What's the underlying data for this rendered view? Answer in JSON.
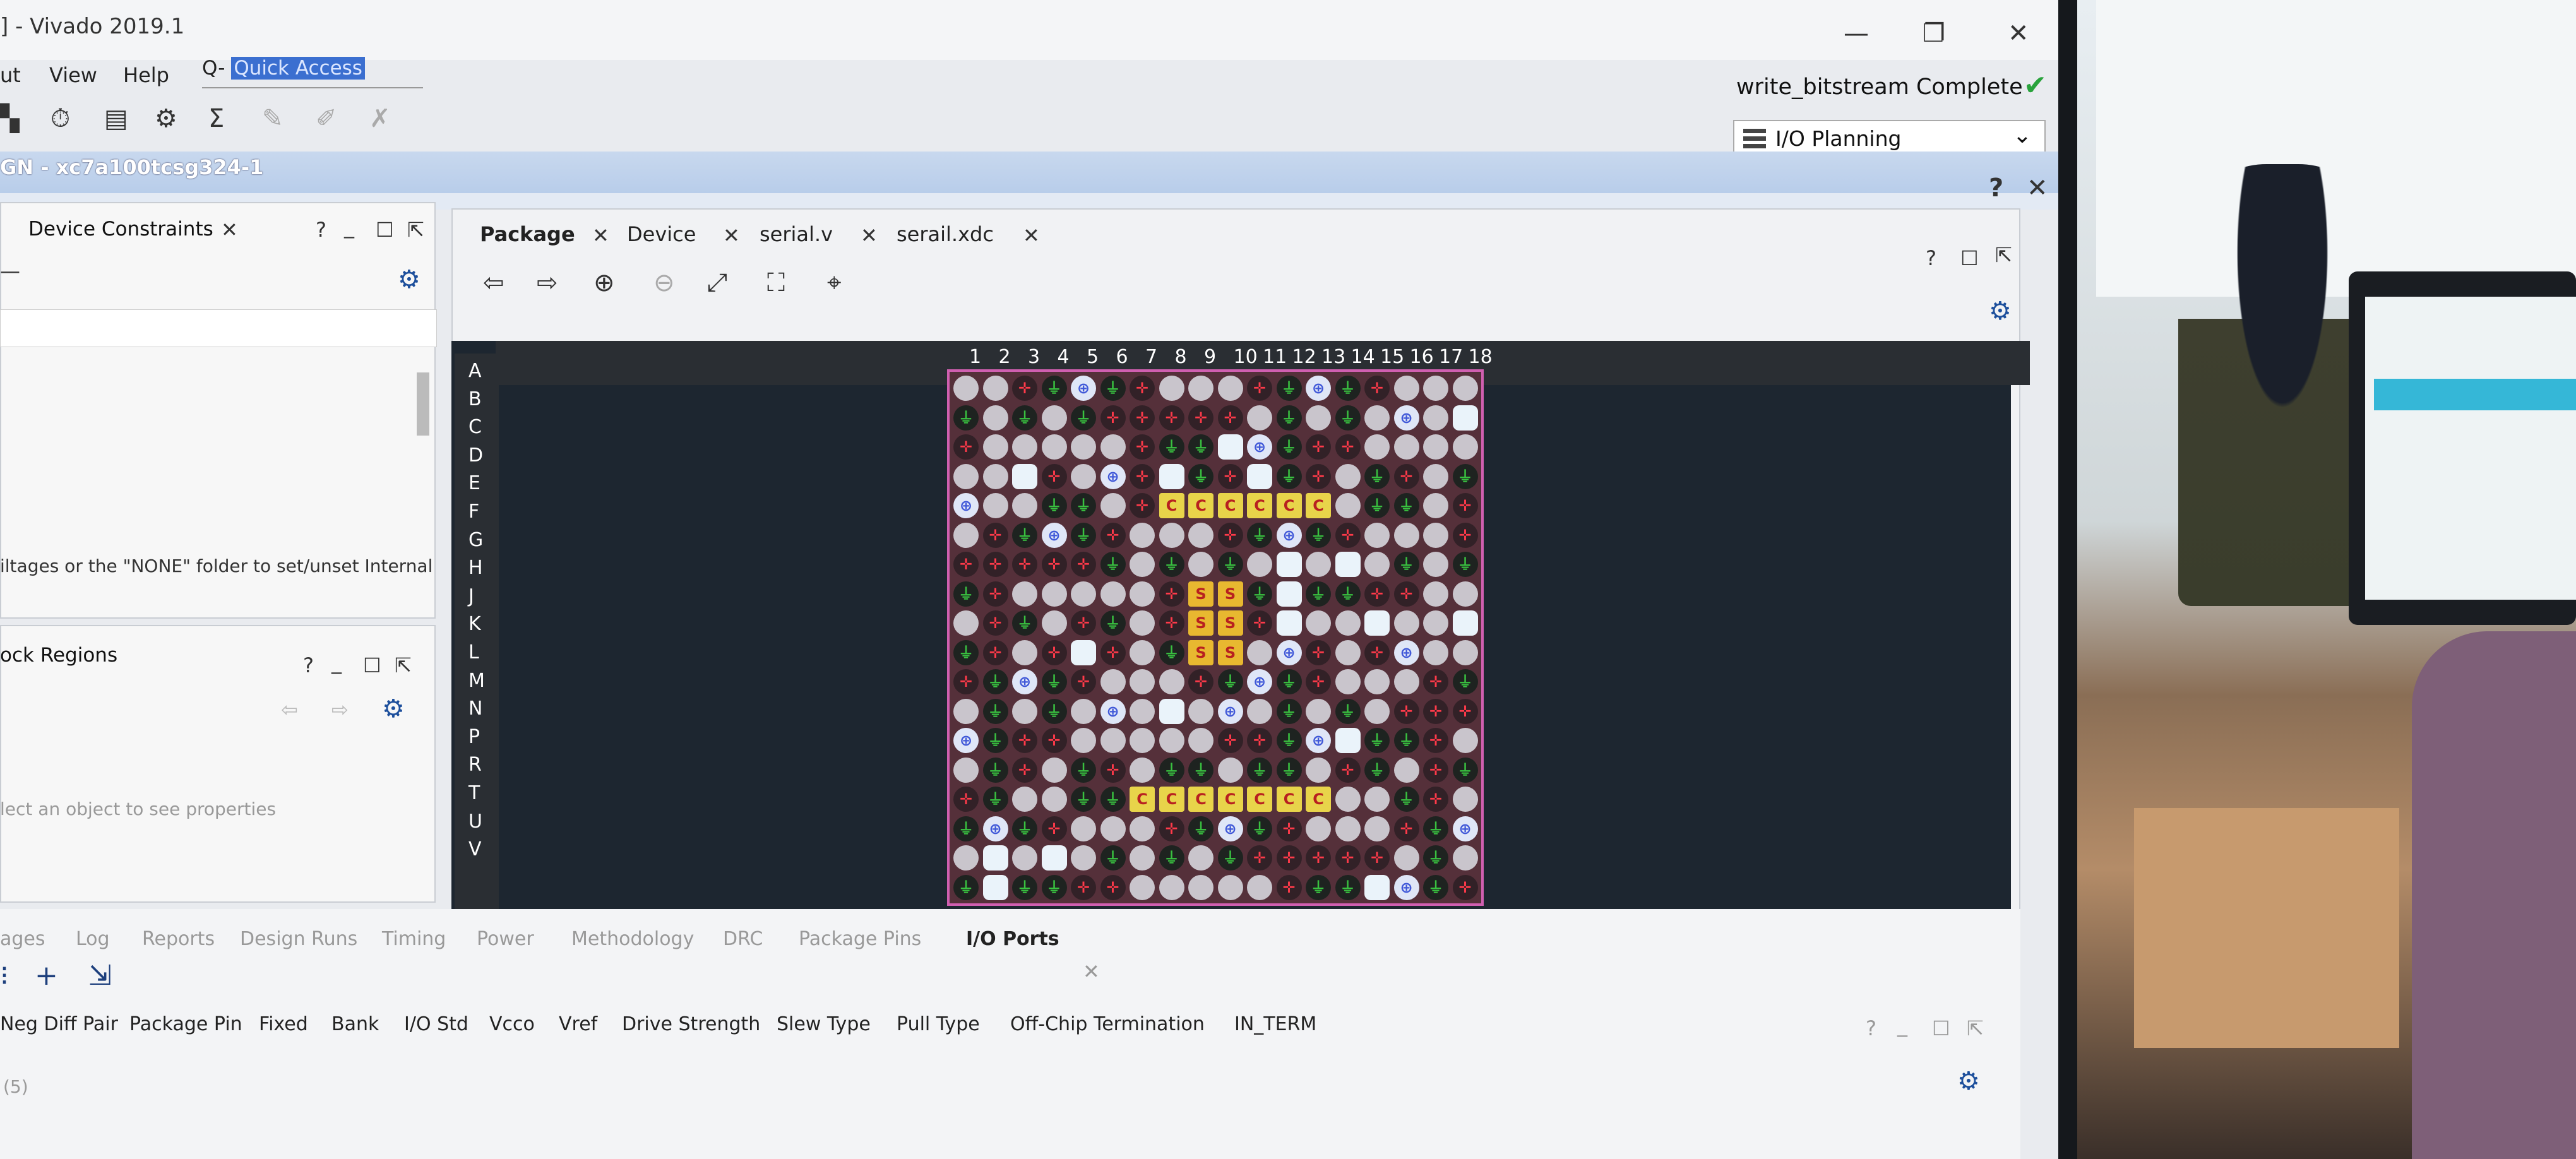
{
  "window": {
    "title": "] - Vivado 2019.1",
    "controls": [
      "—",
      "❐",
      "✕"
    ]
  },
  "menu": [
    "ut",
    "View",
    "Help"
  ],
  "quick_access": {
    "icon": "Q-",
    "value": "Quick Access"
  },
  "status": {
    "text": "write_bitstream Complete",
    "icon": "checkmark-icon"
  },
  "layout": {
    "selected": "I/O Planning"
  },
  "design": {
    "title": "GN - xc7a100tcsg324-1"
  },
  "left_top": {
    "tab": "Device Constraints",
    "hint": "iltages or the \"NONE\" folder to set/unset Internal"
  },
  "left_bottom": {
    "tab": "ock Regions",
    "hint": "lect an object to see properties"
  },
  "package": {
    "tabs": [
      "Package",
      "Device",
      "serial.v",
      "serail.xdc"
    ],
    "columns": [
      "1",
      "2",
      "3",
      "4",
      "5",
      "6",
      "7",
      "8",
      "9",
      "10",
      "11",
      "12",
      "13",
      "14",
      "15",
      "16",
      "17",
      "18"
    ],
    "rows": [
      "A",
      "B",
      "C",
      "D",
      "E",
      "F",
      "G",
      "H",
      "J",
      "K",
      "L",
      "M",
      "N",
      "P",
      "R",
      "T",
      "U",
      "V"
    ]
  },
  "bottom": {
    "tabs": [
      "ages",
      "Log",
      "Reports",
      "Design Runs",
      "Timing",
      "Power",
      "Methodology",
      "DRC",
      "Package Pins",
      "I/O Ports"
    ],
    "active_tab": "I/O Ports",
    "columns": [
      "Neg Diff Pair",
      "Package Pin",
      "Fixed",
      "Bank",
      "I/O Std",
      "Vcco",
      "Vref",
      "Drive Strength",
      "Slew Type",
      "Pull Type",
      "Off-Chip Termination",
      "IN_TERM"
    ],
    "count": "(5)"
  }
}
